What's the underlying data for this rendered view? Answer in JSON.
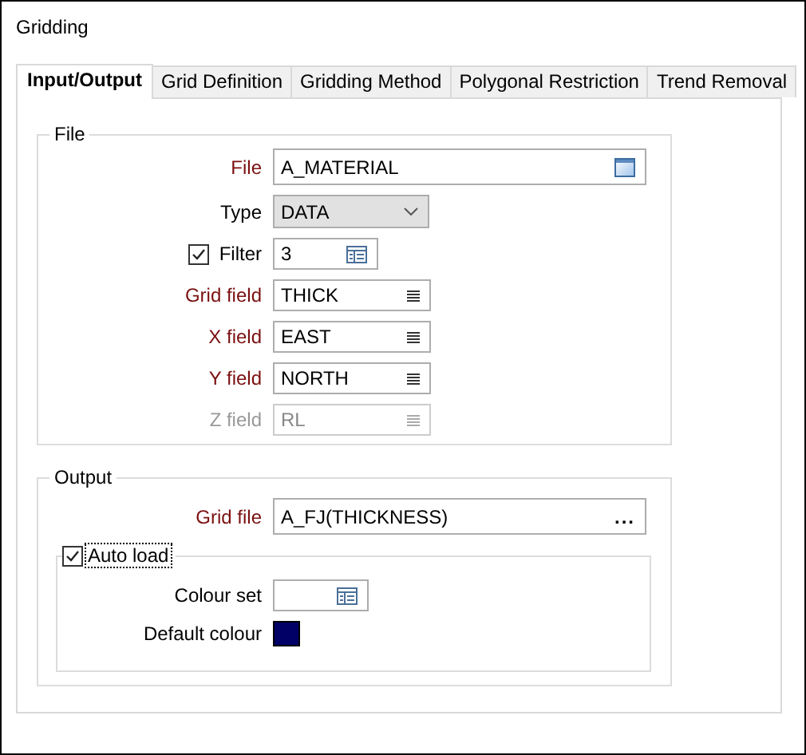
{
  "window": {
    "title": "Gridding"
  },
  "tabs": [
    {
      "label": "Input/Output",
      "selected": true
    },
    {
      "label": "Grid Definition",
      "selected": false
    },
    {
      "label": "Gridding Method",
      "selected": false
    },
    {
      "label": "Polygonal Restriction",
      "selected": false
    },
    {
      "label": "Trend Removal",
      "selected": false
    }
  ],
  "file_group": {
    "title": "File",
    "rows": [
      {
        "kind": "browse",
        "label": "File",
        "required": true,
        "disabled": false,
        "value": "A_MATERIAL"
      },
      {
        "kind": "dropdown",
        "label": "Type",
        "required": false,
        "disabled": false,
        "value": "DATA"
      },
      {
        "kind": "picker",
        "label": "Filter",
        "required": false,
        "disabled": false,
        "checked": true,
        "value": "3"
      },
      {
        "kind": "list",
        "label": "Grid field",
        "required": true,
        "disabled": false,
        "value": "THICK"
      },
      {
        "kind": "list",
        "label": "X field",
        "required": true,
        "disabled": false,
        "value": "EAST"
      },
      {
        "kind": "list",
        "label": "Y field",
        "required": true,
        "disabled": false,
        "value": "NORTH"
      },
      {
        "kind": "list",
        "label": "Z field",
        "required": false,
        "disabled": true,
        "value": "RL"
      }
    ]
  },
  "output_group": {
    "title": "Output",
    "grid_file": {
      "label": "Grid file",
      "required": true,
      "value": "A_FJ(THICKNESS)",
      "button": "..."
    },
    "auto_load": {
      "label": "Auto load",
      "checked": true,
      "colour_set": {
        "label": "Colour set"
      },
      "default_colour": {
        "label": "Default colour",
        "color": "#000066"
      }
    }
  }
}
